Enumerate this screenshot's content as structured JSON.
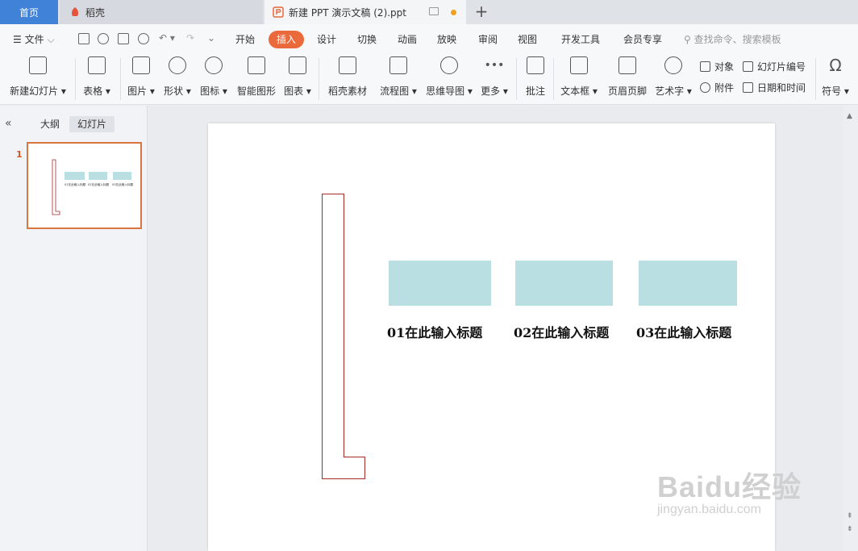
{
  "tabs": {
    "home": "首页",
    "daoke": "稻壳",
    "document": "新建 PPT 演示文稿 (2).ppt",
    "new_tab": "+"
  },
  "menubar": {
    "file": "文件",
    "items": [
      "开始",
      "插入",
      "设计",
      "切换",
      "动画",
      "放映",
      "审阅",
      "视图",
      "开发工具",
      "会员专享"
    ],
    "active": "插入",
    "search_placeholder": "查找命令、搜索模板"
  },
  "ribbon": {
    "new_slide": "新建幻灯片",
    "table": "表格",
    "picture": "图片",
    "shape": "形状",
    "icon": "图标",
    "smart_art": "智能图形",
    "chart": "图表",
    "daoke_material": "稻壳素材",
    "flowchart": "流程图",
    "mindmap": "思维导图",
    "more": "更多",
    "comment": "批注",
    "textbox": "文本框",
    "header_footer": "页眉页脚",
    "wordart": "艺术字",
    "object": "对象",
    "attachment": "附件",
    "slide_number": "幻灯片编号",
    "date_time": "日期和时间",
    "symbol": "符号"
  },
  "leftpanel": {
    "collapse": "«",
    "tab_outline": "大纲",
    "tab_slides": "幻灯片",
    "active_tab": "幻灯片",
    "slide_number": "1"
  },
  "slide": {
    "titles": [
      "01在此输入标题",
      "02在此输入标题",
      "03在此输入标题"
    ],
    "thumb_titles": [
      "01在此输入标题",
      "02在此输入标题",
      "03在此输入标题"
    ]
  },
  "watermark": {
    "main": "Baidu经验",
    "sub": "jingyan.baidu.com"
  },
  "colors": {
    "tab_home": "#3f82d8",
    "menu_active": "#eb6a3c",
    "rect_fill": "#b9dfe3",
    "bracket_stroke": "#a52a2a",
    "thumb_border": "#d9763f"
  }
}
